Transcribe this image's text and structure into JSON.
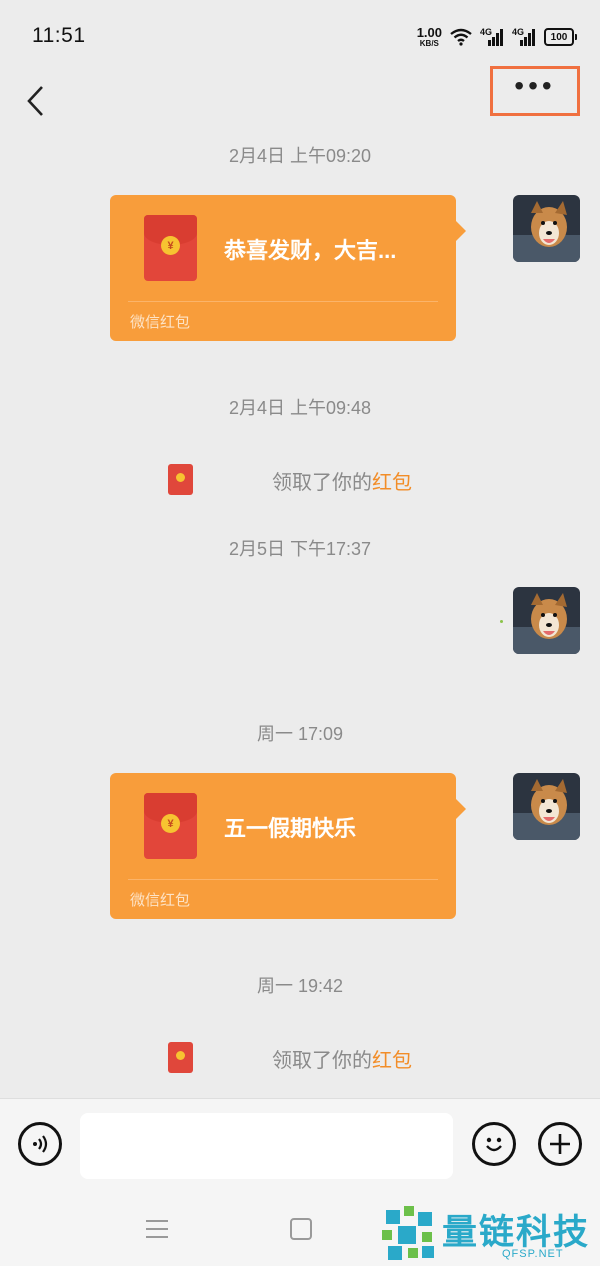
{
  "status_bar": {
    "time": "11:51",
    "net_speed": "1.00",
    "net_unit": "KB/S",
    "signal1": "4G",
    "signal2": "4G",
    "battery": "100"
  },
  "messages": [
    {
      "type": "timestamp",
      "text": "2月4日 上午09:20"
    },
    {
      "type": "red_packet",
      "title": "恭喜发财，大吉...",
      "footer": "微信红包"
    },
    {
      "type": "timestamp",
      "text": "2月4日 上午09:48"
    },
    {
      "type": "claim_notice",
      "text": "领取了你的",
      "link": "红包"
    },
    {
      "type": "timestamp",
      "text": "2月5日 下午17:37"
    },
    {
      "type": "timestamp",
      "text": "周一 17:09"
    },
    {
      "type": "red_packet",
      "title": "五一假期快乐",
      "footer": "微信红包"
    },
    {
      "type": "timestamp",
      "text": "周一 19:42"
    },
    {
      "type": "claim_notice",
      "text": "领取了你的",
      "link": "红包"
    }
  ],
  "icons": {
    "back": "chevron-left-icon",
    "more": "more-dots-icon",
    "voice": "voice-icon",
    "emoji": "emoji-icon",
    "add": "plus-icon",
    "coin": "¥"
  },
  "watermark": {
    "brand": "量链科技",
    "domain": "QFSP.NET"
  },
  "colors": {
    "packet": "#f89d3b",
    "highlight_box": "#f07040",
    "link": "#f28d28",
    "background": "#ececec"
  }
}
